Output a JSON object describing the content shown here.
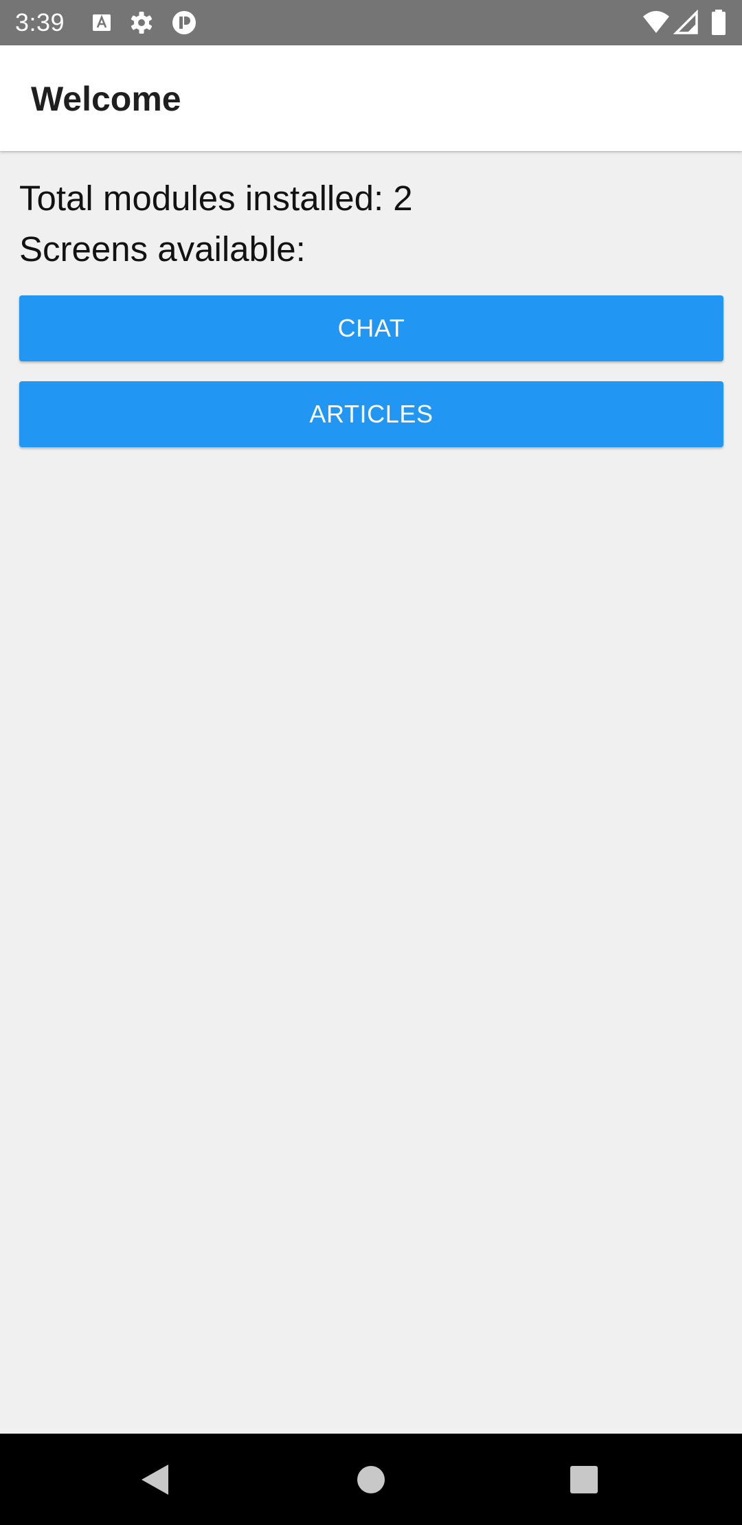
{
  "status_bar": {
    "time": "3:39",
    "left_icons": [
      "keyboard-a-icon",
      "gear-icon",
      "privacy-badge-icon"
    ],
    "right_icons": [
      "wifi-icon",
      "cell-signal-icon",
      "battery-icon"
    ],
    "background": "#757575"
  },
  "app_bar": {
    "title": "Welcome"
  },
  "main": {
    "modules_label": "Total modules installed: ",
    "modules_count": "2",
    "screens_label": "Screens available:",
    "buttons": [
      {
        "label": "CHAT"
      },
      {
        "label": "ARTICLES"
      }
    ]
  },
  "colors": {
    "accent": "#2196f3",
    "background": "#f0f0f0",
    "app_bar": "#ffffff",
    "nav_bar": "#000000"
  },
  "nav_bar": {
    "icons": [
      "back-icon",
      "home-icon",
      "recents-icon"
    ]
  }
}
